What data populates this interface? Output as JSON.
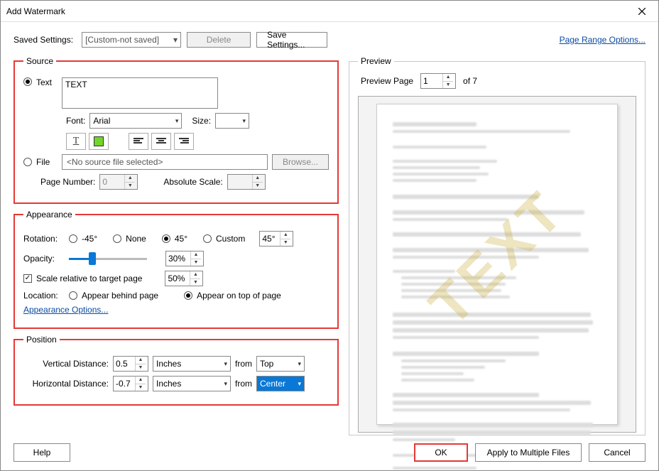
{
  "window": {
    "title": "Add Watermark"
  },
  "toprow": {
    "saved_label": "Saved Settings:",
    "saved_value": "[Custom-not saved]",
    "delete_btn": "Delete",
    "save_btn": "Save Settings...",
    "range_link": "Page Range Options..."
  },
  "source": {
    "legend": "Source",
    "text_radio": "Text",
    "text_value": "TEXT",
    "font_label": "Font:",
    "font_value": "Arial",
    "size_label": "Size:",
    "size_value": "",
    "file_radio": "File",
    "file_path": "<No source file selected>",
    "browse_btn": "Browse...",
    "page_num_label": "Page Number:",
    "page_num_value": "0",
    "abs_scale_label": "Absolute Scale:",
    "abs_scale_value": ""
  },
  "appearance": {
    "legend": "Appearance",
    "rotation_label": "Rotation:",
    "rot_n45": "-45°",
    "rot_none": "None",
    "rot_45": "45°",
    "rot_custom": "Custom",
    "rot_custom_value": "45°",
    "opacity_label": "Opacity:",
    "opacity_value": "30%",
    "opacity_percent": 30,
    "scale_check": "Scale relative to target page",
    "scale_value": "50%",
    "location_label": "Location:",
    "loc_behind": "Appear behind page",
    "loc_top": "Appear on top of page",
    "options_link": "Appearance Options..."
  },
  "position": {
    "legend": "Position",
    "vdist_label": "Vertical Distance:",
    "vdist_value": "0.5",
    "vdist_unit": "Inches",
    "from_label": "from",
    "vdist_from": "Top",
    "hdist_label": "Horizontal Distance:",
    "hdist_value": "-0.7",
    "hdist_unit": "Inches",
    "hdist_from": "Center"
  },
  "preview": {
    "legend": "Preview",
    "page_label": "Preview Page",
    "page_value": "1",
    "of_label": "of 7",
    "watermark": "TEXT"
  },
  "footer": {
    "help": "Help",
    "ok": "OK",
    "multi": "Apply to Multiple Files",
    "cancel": "Cancel"
  }
}
